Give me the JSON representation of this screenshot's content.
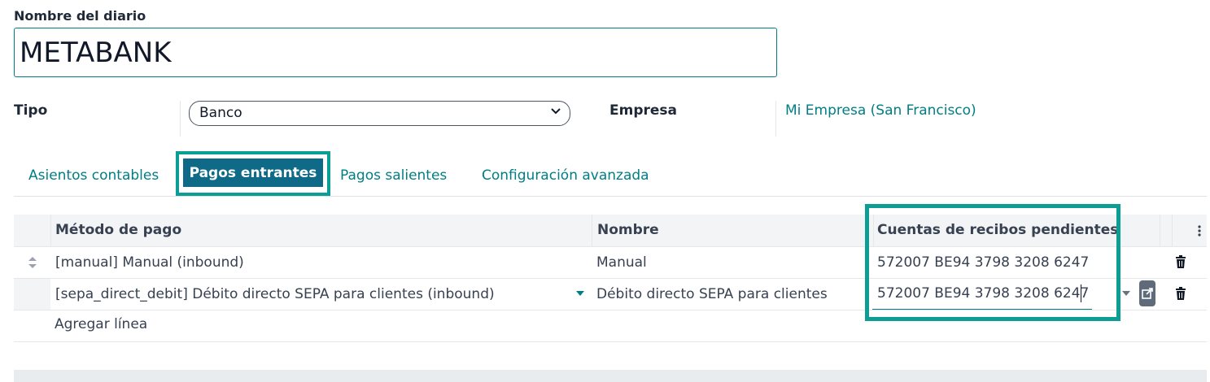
{
  "journal": {
    "name_label": "Nombre del diario",
    "name_value": "METABANK",
    "type_label": "Tipo",
    "type_value": "Banco",
    "company_label": "Empresa",
    "company_value": "Mi Empresa (San Francisco)"
  },
  "tabs": [
    {
      "label": "Asientos contables",
      "active": false
    },
    {
      "label": "Pagos entrantes",
      "active": true
    },
    {
      "label": "Pagos salientes",
      "active": false
    },
    {
      "label": "Configuración avanzada",
      "active": false
    }
  ],
  "table": {
    "columns": [
      "Método de pago",
      "Nombre",
      "Cuentas de recibos pendientes"
    ],
    "rows": [
      {
        "method": "[manual] Manual (inbound)",
        "name": "Manual",
        "account": "572007 BE94 3798 3208 6247"
      },
      {
        "method": "[sepa_direct_debit] Débito directo SEPA para clientes (inbound)",
        "name": "Débito directo SEPA para clientes",
        "account": "572007 BE94 3798 3208 6247"
      }
    ],
    "add_line": "Agregar línea"
  },
  "icons": {
    "select_chevron": "chevron-down-icon",
    "sort_handle": "sort-handle-icon",
    "delete": "trash-icon",
    "options": "kebab-menu-icon",
    "external": "external-link-icon"
  },
  "colors": {
    "accent": "#017e84",
    "highlight": "#0c9d94",
    "active_tab": "#0e6a86"
  }
}
